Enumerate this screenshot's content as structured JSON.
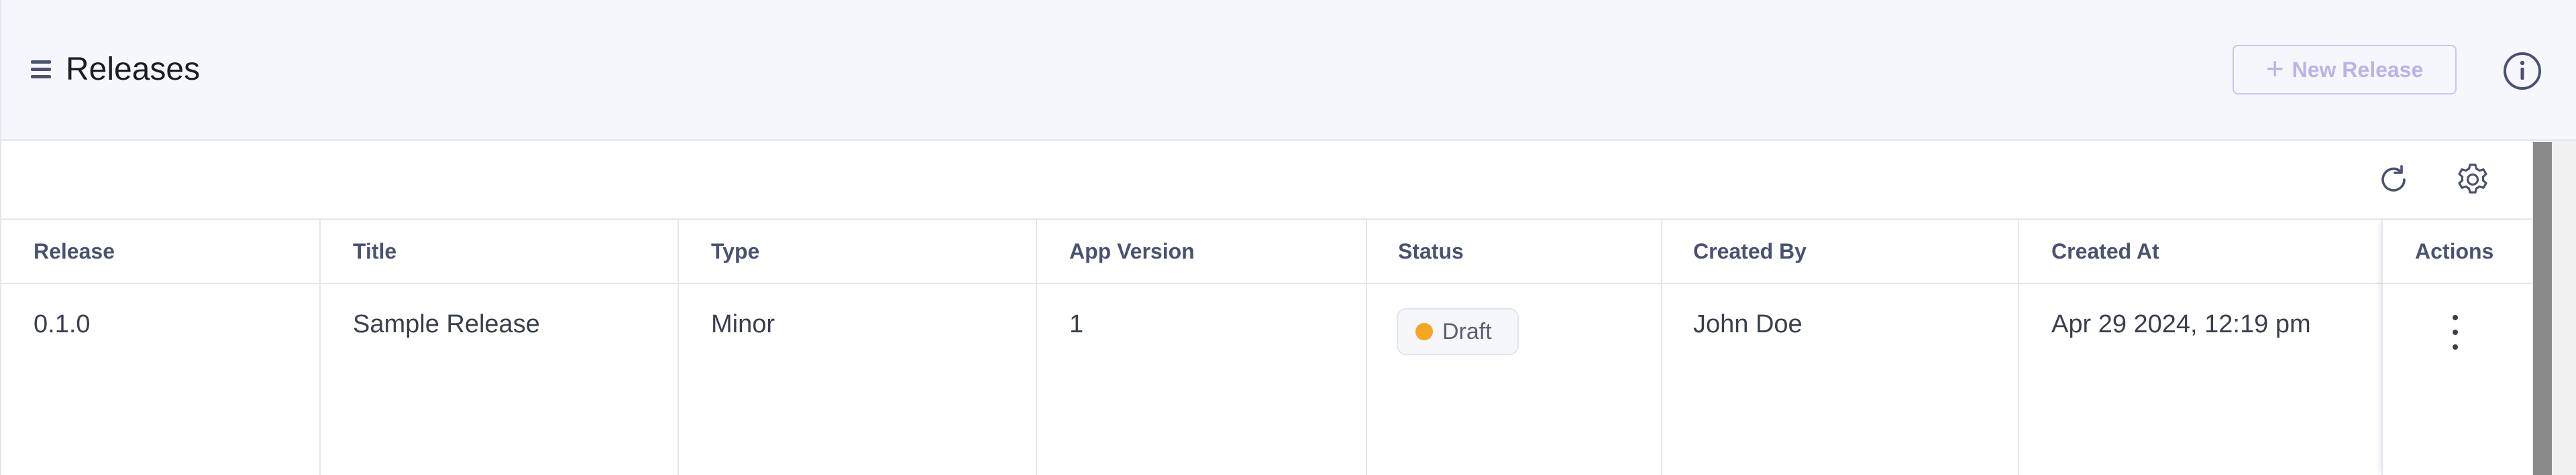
{
  "header": {
    "title": "Releases",
    "new_release_label": "New Release",
    "new_release_plus": "+"
  },
  "icons": {
    "menu": "menu-icon",
    "info": "info-icon",
    "refresh": "refresh-icon",
    "settings": "gear-icon",
    "actions": "more-vertical-icon"
  },
  "table": {
    "columns": [
      "Release",
      "Title",
      "Type",
      "App Version",
      "Status",
      "Created By",
      "Created At",
      "Actions"
    ],
    "rows": [
      {
        "release": "0.1.0",
        "title": "Sample Release",
        "type": "Minor",
        "app_version": "1",
        "status": "Draft",
        "created_by": "John Doe",
        "created_at": "Apr 29 2024, 12:19 pm"
      }
    ]
  },
  "colors": {
    "header_bg": "#f6f7fc",
    "border": "#e3e6ef",
    "accent_disabled": "#b8b3e8",
    "status_draft": "#f5a623",
    "header_text": "#4a5270"
  }
}
